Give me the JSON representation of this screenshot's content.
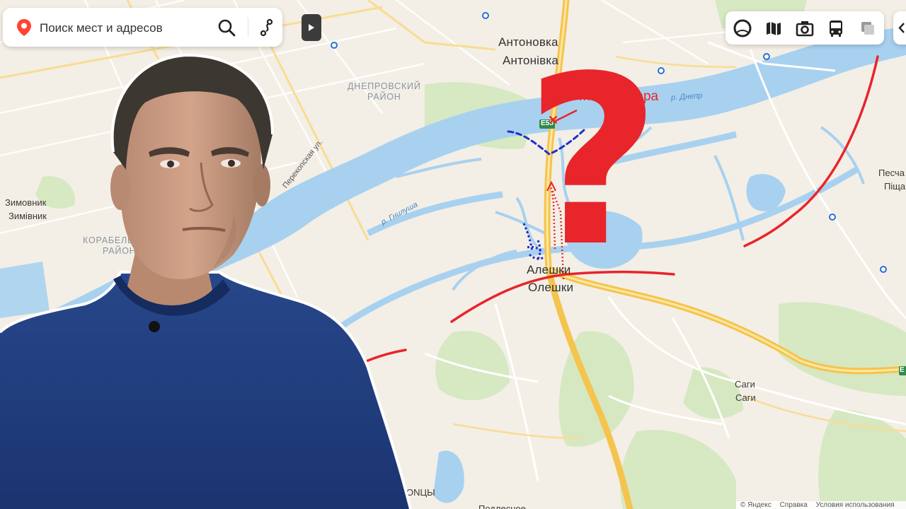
{
  "search": {
    "placeholder": "Поиск мест и адресов"
  },
  "controls": {
    "search_icon": "search-icon",
    "route_icon": "route-icon",
    "panel_toggle_icon": "play-arrow-icon",
    "layers": [
      {
        "name": "panorama-icon"
      },
      {
        "name": "map-layers-icon"
      },
      {
        "name": "camera-icon"
      },
      {
        "name": "bus-icon"
      },
      {
        "name": "layers-stack-icon"
      }
    ]
  },
  "map": {
    "towns": [
      {
        "name": "Антоновка"
      },
      {
        "name": "Антонівка"
      },
      {
        "name": "Алешки"
      },
      {
        "name": "Олешки"
      },
      {
        "name": "Саги"
      },
      {
        "name": "Саги"
      },
      {
        "name": "Зимовник"
      },
      {
        "name": "Зимівник"
      },
      {
        "name": "Песча"
      },
      {
        "name": "Піща"
      }
    ],
    "districts": {
      "dnieper_line1": "ДНЕПРОВСКИЙ",
      "dnieper_line2": "РАЙОН",
      "korabel_line1": "КОРАБЕЛЬНЫЙ",
      "korabel_line2": "РАЙОН"
    },
    "rivers": {
      "dnepr": "р. Днепр",
      "gnilusha": "р. Гнилуша"
    },
    "street": "Перекопская ул.",
    "road_badges": {
      "e58": "E58",
      "east": "E"
    },
    "bottom_partial": {
      "left": "ONЦЫ",
      "center": "Подлесное"
    },
    "strike_label": "Место удара",
    "strike_marker": "✕",
    "question_mark": "?",
    "colors": {
      "water": "#a8d1ef",
      "land": "#f3efe6",
      "green": "#cfe7b8",
      "highway": "#f6c14e",
      "front_line": "#e8252a",
      "troops": "#1f2fc9",
      "question": "#e8252a"
    }
  },
  "footer": {
    "copyright": "© Яндекс",
    "help": "Справка",
    "terms": "Условия использования"
  }
}
